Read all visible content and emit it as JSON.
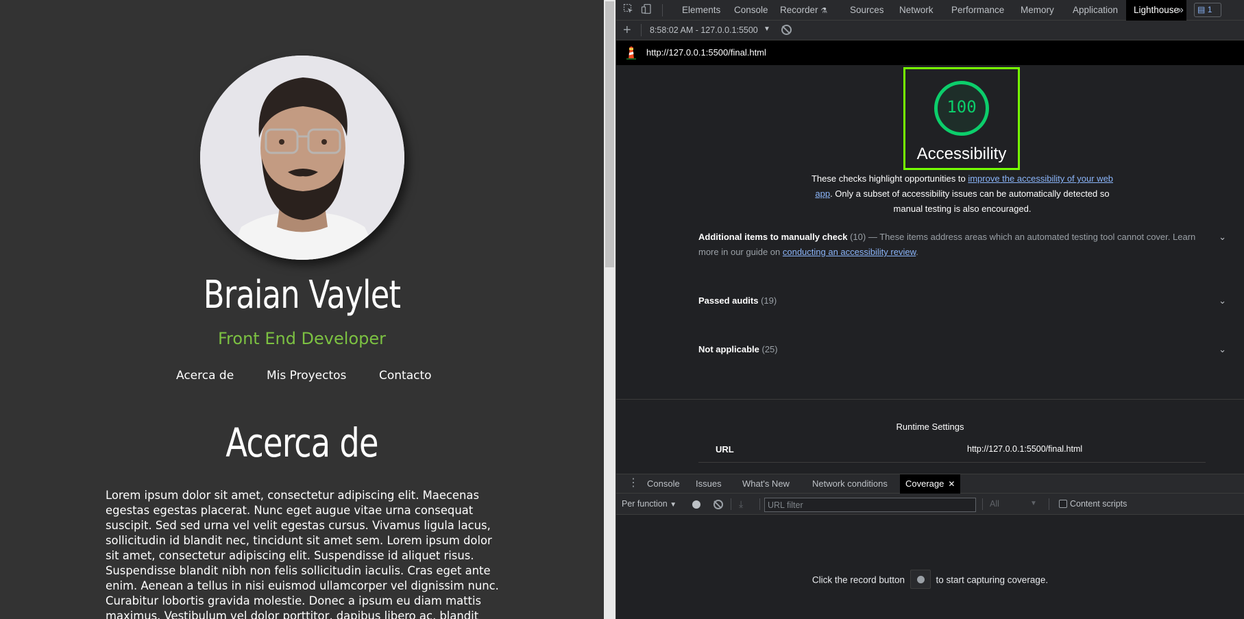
{
  "page": {
    "name": "Braian Vaylet",
    "role": "Front End Developer",
    "nav": [
      "Acerca de",
      "Mis Proyectos",
      "Contacto"
    ],
    "about_title": "Acerca de",
    "about_text": "Lorem ipsum dolor sit amet, consectetur adipiscing elit. Maecenas egestas egestas placerat. Nunc eget augue vitae urna consequat suscipit. Sed sed urna vel velit egestas cursus. Vivamus ligula lacus, sollicitudin id blandit nec, tincidunt sit amet sem. Lorem ipsum dolor sit amet, consectetur adipiscing elit. Suspendisse id aliquet risus. Suspendisse blandit nibh non felis sollicitudin iaculis. Cras eget ante enim. Aenean a tellus in nisi euismod ullamcorper vel dignissim nunc. Curabitur lobortis gravida molestie. Donec a ipsum eu diam mattis maximus. Vestibulum vel dolor porttitor, dapibus libero ac, blandit neque. Donec elit enim, porta ut sollicitudin a, suscipit ac"
  },
  "devtools": {
    "tabs": [
      "Elements",
      "Console",
      "Recorder",
      "Sources",
      "Network",
      "Performance",
      "Memory",
      "Application",
      "Lighthouse"
    ],
    "active_tab": "Lighthouse",
    "more_tabs": "»",
    "issues_count": "1",
    "run_label": "8:58:02 AM - 127.0.0.1:5500",
    "report_url": "http://127.0.0.1:5500/final.html",
    "score": "100",
    "category": "Accessibility",
    "desc_before": "These checks highlight opportunities to ",
    "desc_link": "improve the accessibility of your web app",
    "desc_after": ". Only a subset of accessibility issues can be automatically detected so manual testing is also encouraged.",
    "groups": {
      "manual": {
        "title": "Additional items to manually check",
        "count": "(10)",
        "text_before": "— These items address areas which an automated testing tool cannot cover. Learn more in our guide on ",
        "link": "conducting an accessibility review",
        "text_after": "."
      },
      "passed": {
        "title": "Passed audits",
        "count": "(19)"
      },
      "na": {
        "title": "Not applicable",
        "count": "(25)"
      }
    },
    "runtime_title": "Runtime Settings",
    "runtime_url_label": "URL",
    "runtime_url_value": "http://127.0.0.1:5500/final.html",
    "drawer_tabs": [
      "Console",
      "Issues",
      "What's New",
      "Network conditions",
      "Coverage"
    ],
    "drawer_active": "Coverage",
    "coverage": {
      "mode": "Per function",
      "filter_placeholder": "URL filter",
      "type": "All",
      "content_scripts": "Content scripts",
      "empty_before": "Click the record button",
      "empty_after": "to start capturing coverage."
    }
  },
  "colors": {
    "accent_green": "#7cc142",
    "score_green": "#0cce6b",
    "highlight": "#76ff03",
    "link": "#8ab4f8"
  }
}
